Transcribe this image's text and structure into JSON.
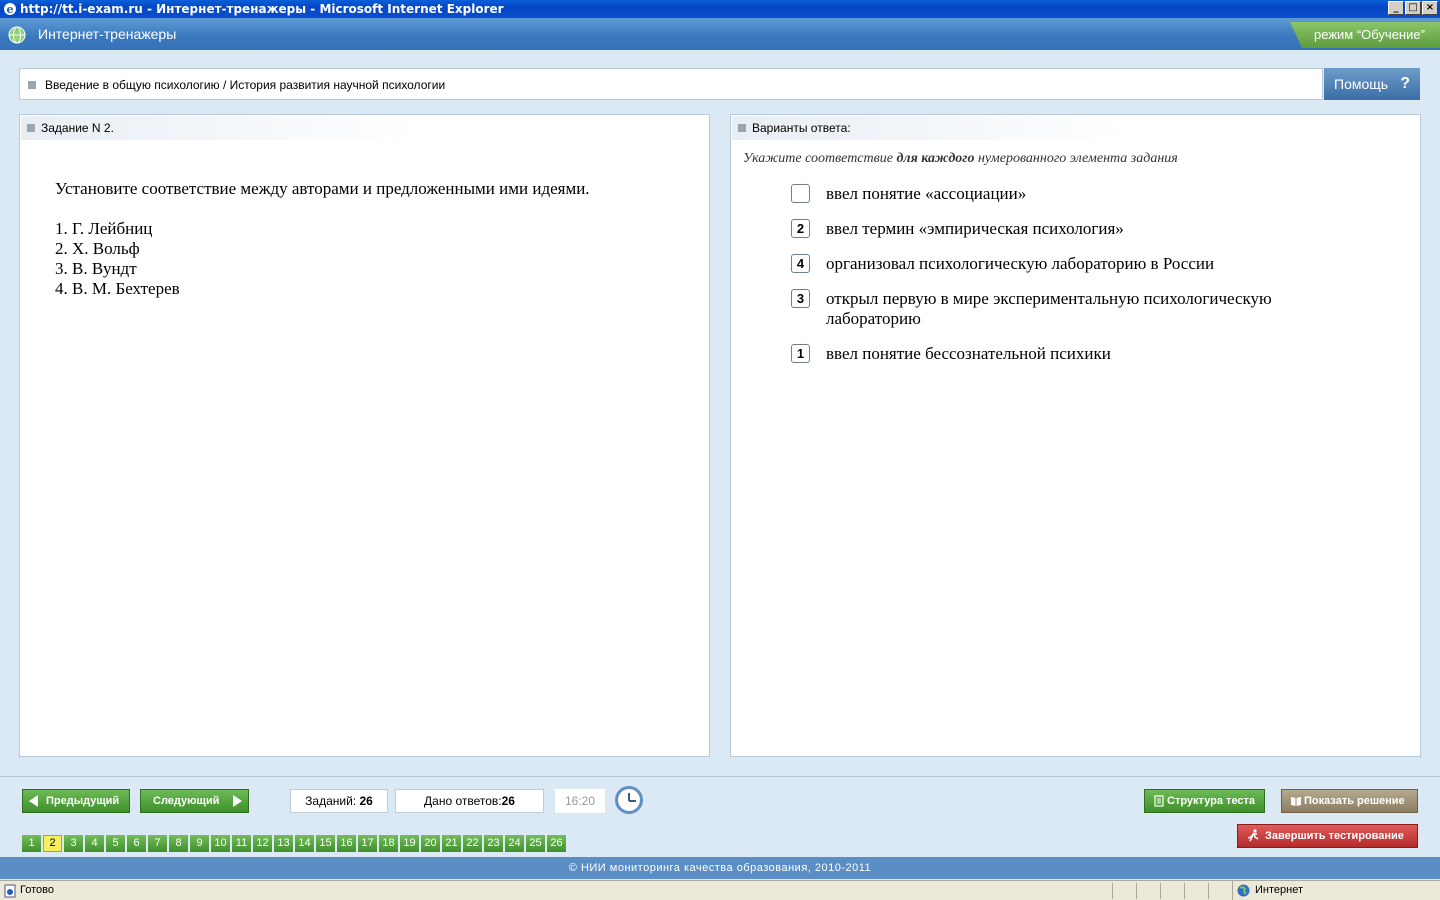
{
  "window": {
    "title": "http://tt.i-exam.ru - Интернет-тренажеры - Microsoft Internet Explorer",
    "buttons": [
      "_",
      "□",
      "×"
    ]
  },
  "header": {
    "app_title": "Интернет-тренажеры",
    "mode": "режим “Обучение”"
  },
  "breadcrumb": {
    "text": "Введение в общую психологию / История развития научной психологии",
    "help_label": "Помощь",
    "help_icon": "?"
  },
  "task": {
    "header": "Задание N 2.",
    "question": "Установите соответствие между авторами и предложенными ими идеями.",
    "items": [
      "1. Г. Лейбниц",
      "2. Х. Вольф",
      "3. В. Вундт",
      "4. В. М. Бехтерев"
    ]
  },
  "answers": {
    "header": "Варианты ответа:",
    "instruction_pre": "Укажите соответствие ",
    "instruction_bold": "для каждого",
    "instruction_post": " нумерованного элемента задания",
    "options": [
      {
        "value": "",
        "text": "ввел понятие «ассоциации»"
      },
      {
        "value": "2",
        "text": "ввел термин «эмпирическая психология»"
      },
      {
        "value": "4",
        "text": "организовал психологическую лабораторию в России"
      },
      {
        "value": "3",
        "text": "открыл первую в мире экспериментальную психологическую лабораторию"
      },
      {
        "value": "1",
        "text": "ввел понятие бессознательной психики"
      }
    ]
  },
  "navigation": {
    "prev_label": "Предыдущий",
    "next_label": "Следующий",
    "tasks_label": "Заданий:",
    "tasks_count": "26",
    "answered_label": "Дано ответов:",
    "answered_count": "26",
    "timer": "16:20",
    "pages": [
      "1",
      "2",
      "3",
      "4",
      "5",
      "6",
      "7",
      "8",
      "9",
      "10",
      "11",
      "12",
      "13",
      "14",
      "15",
      "16",
      "17",
      "18",
      "19",
      "20",
      "21",
      "22",
      "23",
      "24",
      "25",
      "26"
    ],
    "active_page": "2",
    "structure_label": "Структура теста",
    "show_solution_label": "Показать решение",
    "finish_label": "Завершить тестирование"
  },
  "footer": {
    "copyright": "© НИИ мониторинга качества образования, 2010-2011"
  },
  "statusbar": {
    "status": "Готово",
    "zone": "Интернет"
  },
  "colors": {
    "header_blue": "#3a78bd",
    "accent_green": "#3e8f2c",
    "finish_red": "#b42c2c",
    "active_page_yellow": "#f5ef5f"
  }
}
